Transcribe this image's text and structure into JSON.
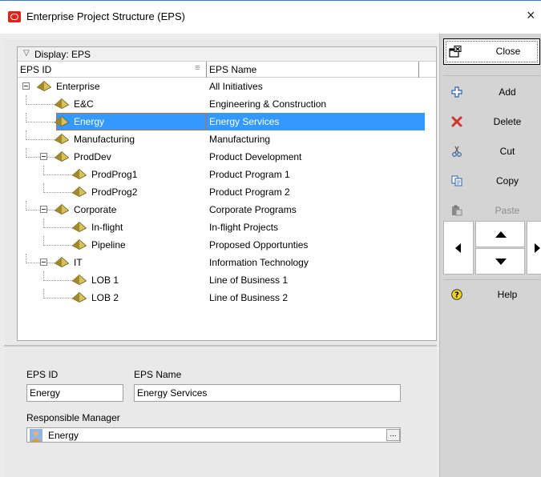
{
  "window": {
    "title": "Enterprise Project Structure (EPS)",
    "close_glyph": "×"
  },
  "tree": {
    "display_label": "Display: EPS",
    "columns": {
      "id": "EPS ID",
      "name": "EPS Name"
    },
    "rows": [
      {
        "id": "Enterprise",
        "name": "All  Initiatives",
        "level": 0,
        "expandable": true
      },
      {
        "id": "E&C",
        "name": "Engineering & Construction",
        "level": 1,
        "expandable": false
      },
      {
        "id": "Energy",
        "name": "Energy Services",
        "level": 1,
        "expandable": false,
        "selected": true
      },
      {
        "id": "Manufacturing",
        "name": "Manufacturing",
        "level": 1,
        "expandable": false
      },
      {
        "id": "ProdDev",
        "name": "Product Development",
        "level": 1,
        "expandable": true
      },
      {
        "id": "ProdProg1",
        "name": "Product Program 1",
        "level": 2,
        "expandable": false
      },
      {
        "id": "ProdProg2",
        "name": "Product Program 2",
        "level": 2,
        "expandable": false
      },
      {
        "id": "Corporate",
        "name": "Corporate Programs",
        "level": 1,
        "expandable": true
      },
      {
        "id": "In-flight",
        "name": "In-flight Projects",
        "level": 2,
        "expandable": false
      },
      {
        "id": "Pipeline",
        "name": "Proposed Opportunties",
        "level": 2,
        "expandable": false
      },
      {
        "id": "IT",
        "name": "Information Technology",
        "level": 1,
        "expandable": true
      },
      {
        "id": "LOB 1",
        "name": "Line of Business 1",
        "level": 2,
        "expandable": false
      },
      {
        "id": "LOB 2",
        "name": "Line of Business 2",
        "level": 2,
        "expandable": false
      }
    ]
  },
  "details": {
    "eps_id_label": "EPS ID",
    "eps_id_value": "Energy",
    "eps_name_label": "EPS Name",
    "eps_name_value": "Energy Services",
    "manager_label": "Responsible Manager",
    "manager_value": "Energy",
    "browse_glyph": "..."
  },
  "buttons": {
    "close": "Close",
    "add": "Add",
    "delete": "Delete",
    "cut": "Cut",
    "copy": "Copy",
    "paste": "Paste",
    "help": "Help"
  },
  "colors": {
    "selection": "#3399ff",
    "node_icon": "#d8c15a",
    "delete_icon": "#d0342c",
    "add_icon": "#2a5fb4"
  }
}
